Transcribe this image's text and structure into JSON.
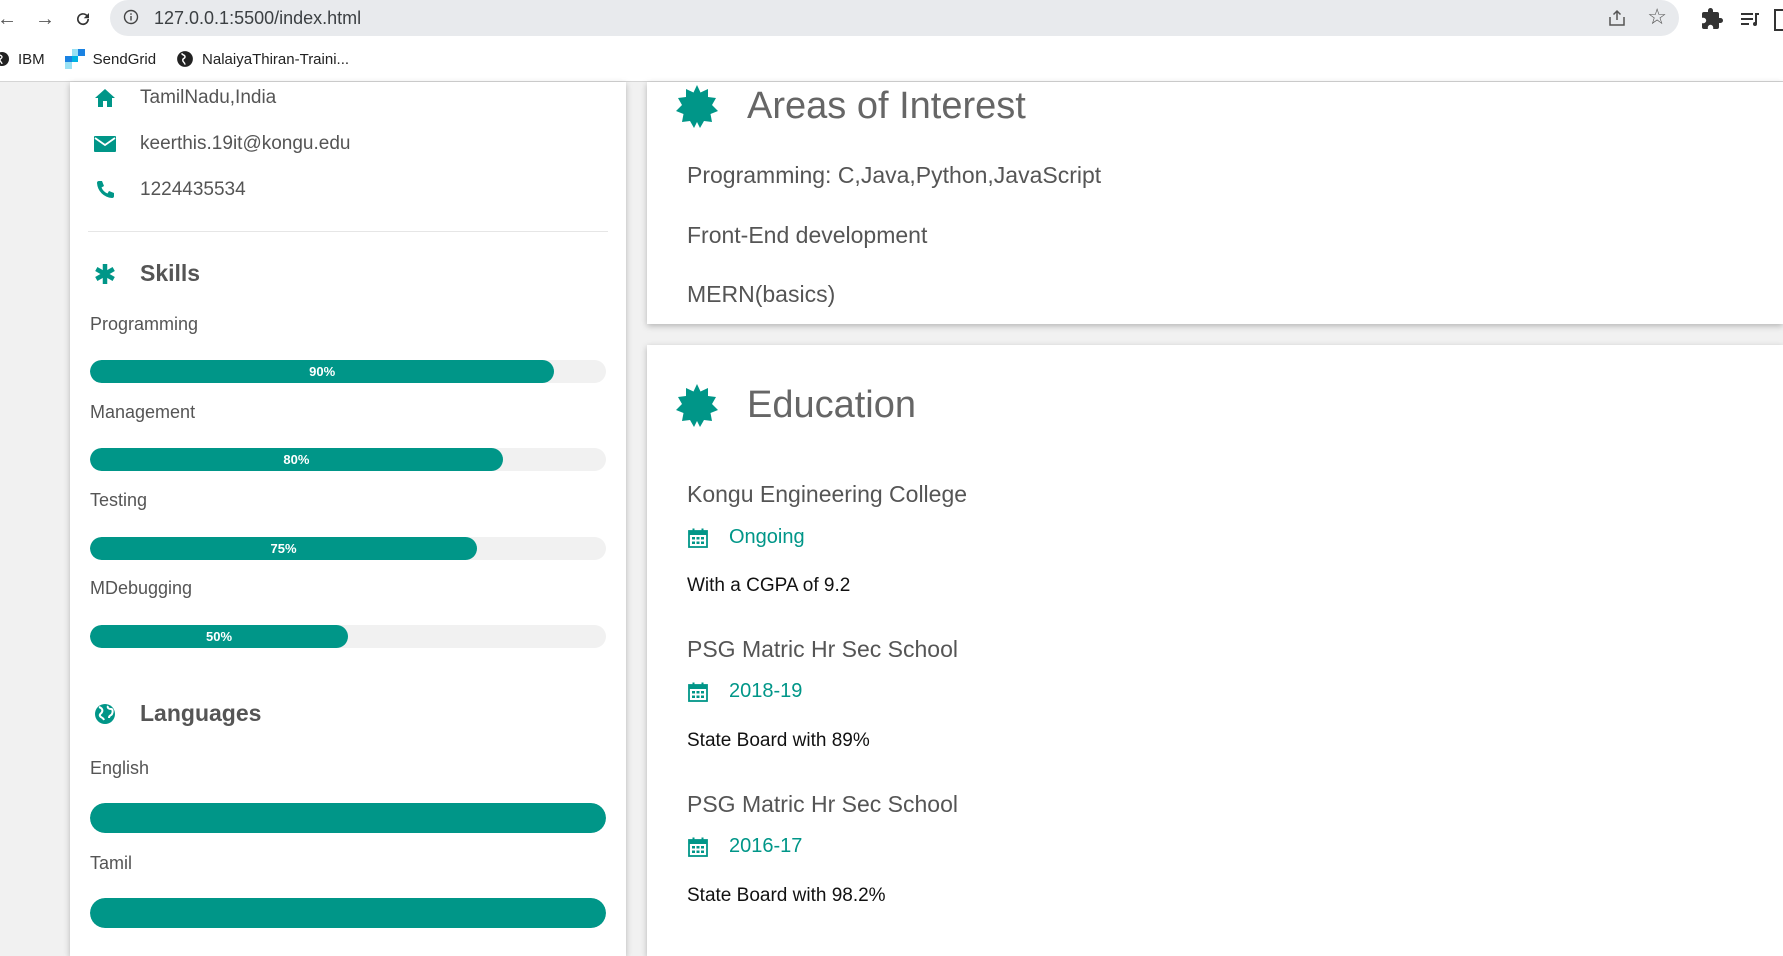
{
  "browser": {
    "url": "127.0.0.1:5500/index.html",
    "bookmarks": [
      {
        "label": "IBM",
        "icon": "globe-icon"
      },
      {
        "label": "SendGrid",
        "icon": "sendgrid-icon"
      },
      {
        "label": "NalaiyaThiran-Traini...",
        "icon": "globe-icon"
      }
    ]
  },
  "contact": {
    "location": "TamilNadu,India",
    "email": "keerthis.19it@kongu.edu",
    "phone": "1224435534"
  },
  "skills": {
    "title": "Skills",
    "items": [
      {
        "label": "Programming",
        "percent": 90,
        "text": "90%"
      },
      {
        "label": "Management",
        "percent": 80,
        "text": "80%"
      },
      {
        "label": "Testing",
        "percent": 75,
        "text": "75%"
      },
      {
        "label": "MDebugging",
        "percent": 50,
        "text": "50%"
      }
    ]
  },
  "languages": {
    "title": "Languages",
    "items": [
      {
        "label": "English",
        "percent": 100
      },
      {
        "label": "Tamil",
        "percent": 100
      }
    ]
  },
  "interests": {
    "title": "Areas of Interest",
    "items": [
      "Programming: C,Java,Python,JavaScript",
      "Front-End development",
      "MERN(basics)"
    ]
  },
  "education": {
    "title": "Education",
    "items": [
      {
        "school": "Kongu Engineering College",
        "period": "Ongoing",
        "desc": "With a CGPA of 9.2"
      },
      {
        "school": "PSG Matric Hr Sec School",
        "period": "2018-19",
        "desc": "State Board with 89%"
      },
      {
        "school": "PSG Matric Hr Sec School",
        "period": "2016-17",
        "desc": "State Board with 98.2%"
      }
    ]
  },
  "colors": {
    "accent": "#009688",
    "track": "#f1f1f1"
  }
}
